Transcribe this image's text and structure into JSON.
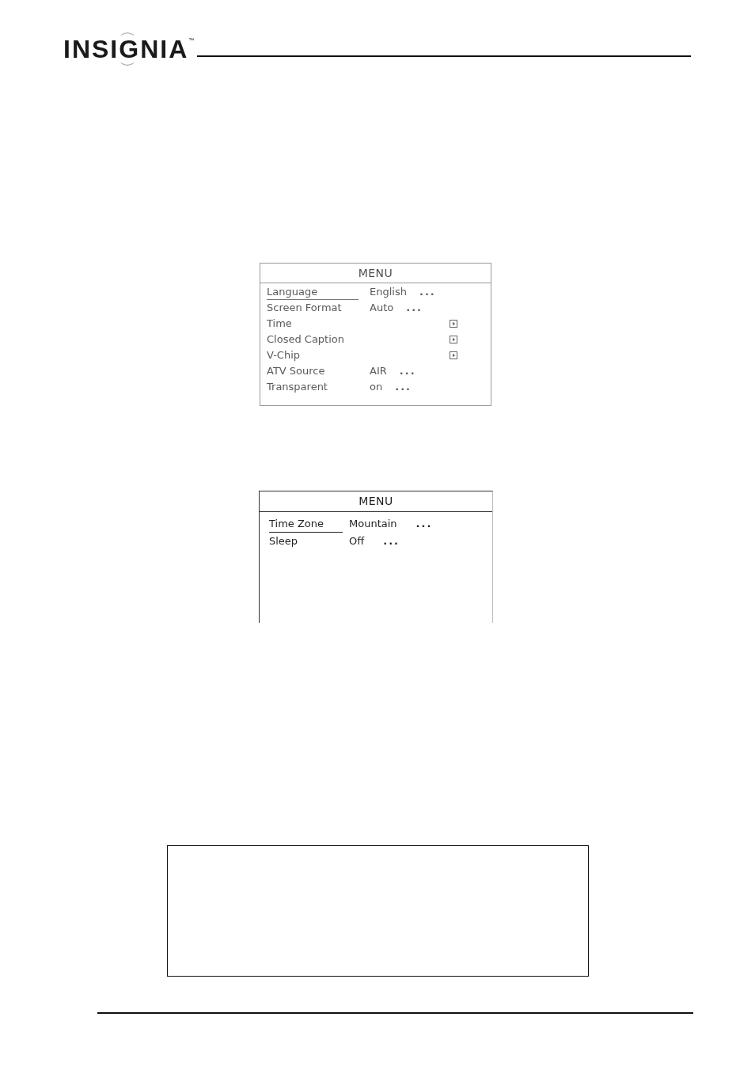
{
  "header": {
    "logo": "INSIGNIA",
    "trademark": "™"
  },
  "menus": [
    {
      "title": "MENU",
      "rows": [
        {
          "kind": "option",
          "label": "Language",
          "value": "English",
          "more": "...",
          "selected": true
        },
        {
          "kind": "option",
          "label": "Screen Format",
          "value": "Auto",
          "more": "...",
          "selected": false
        },
        {
          "kind": "submenu",
          "label": "Time",
          "selected": false
        },
        {
          "kind": "submenu",
          "label": "Closed Caption",
          "selected": false
        },
        {
          "kind": "submenu",
          "label": "V-Chip",
          "selected": false
        },
        {
          "kind": "option",
          "label": "ATV Source",
          "value": "AIR",
          "more": "...",
          "selected": false
        },
        {
          "kind": "option",
          "label": "Transparent",
          "value": "on",
          "more": "...",
          "selected": false
        }
      ]
    },
    {
      "title": "MENU",
      "rows": [
        {
          "kind": "option",
          "label": "Time Zone",
          "value": "Mountain",
          "more": "...",
          "selected": true
        },
        {
          "kind": "option",
          "label": "Sleep",
          "value": "Off",
          "more": "...",
          "selected": false
        }
      ]
    }
  ]
}
